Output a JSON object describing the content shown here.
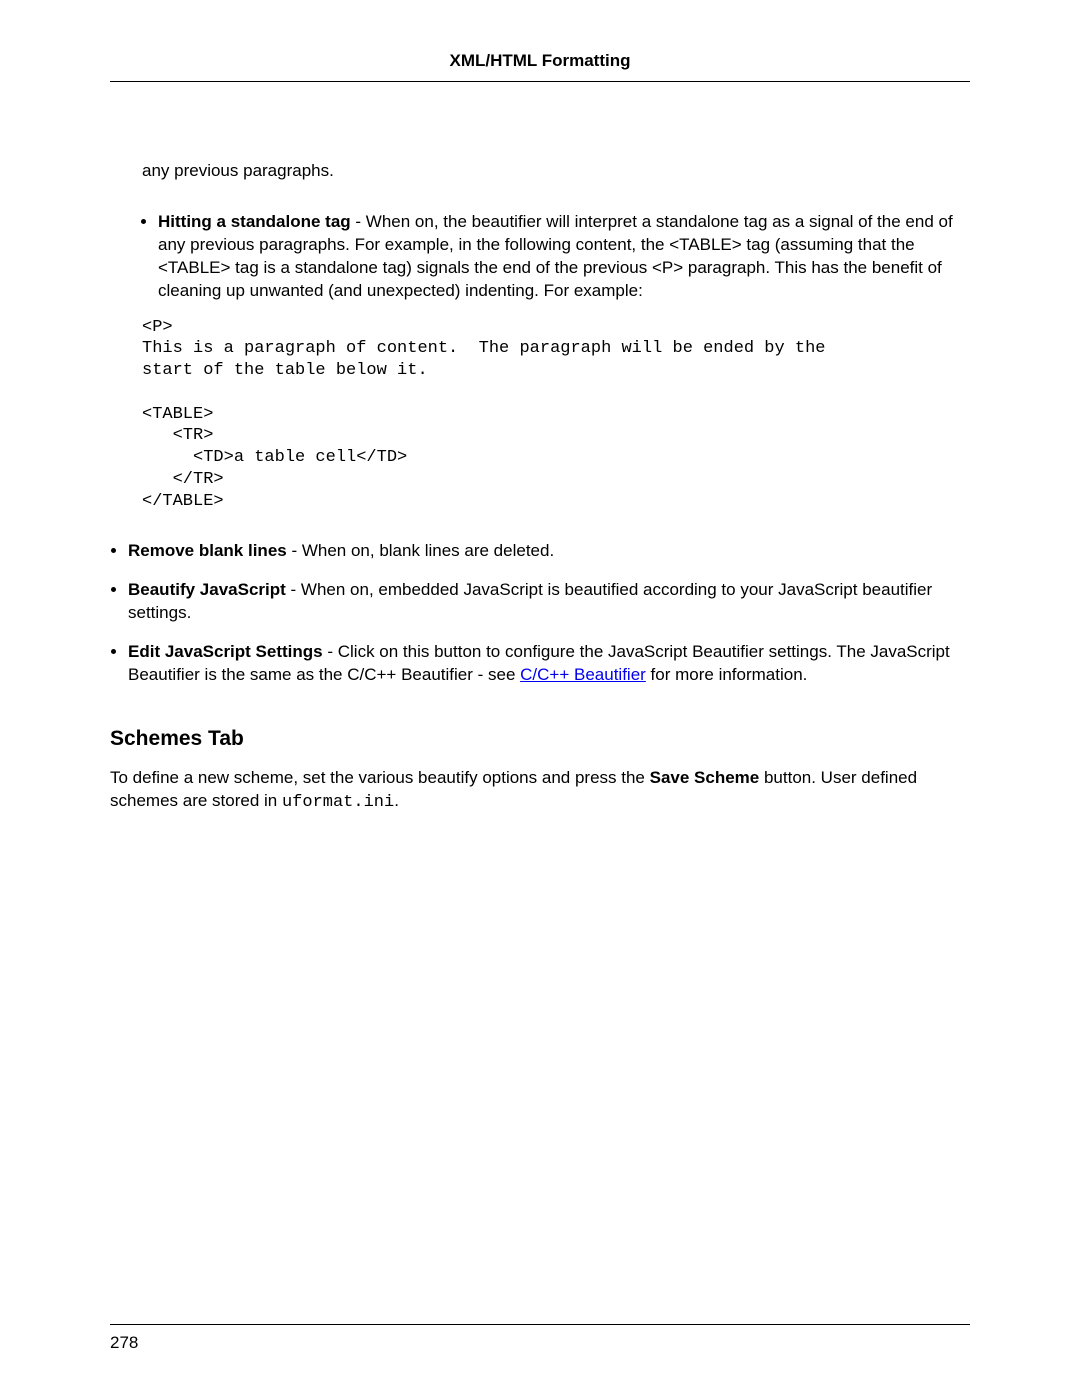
{
  "header": {
    "title": "XML/HTML Formatting"
  },
  "continuation": "any previous paragraphs.",
  "nested_bullet": {
    "label": "Hitting a standalone tag",
    "text": " - When on, the beautifier will interpret a standalone tag as a signal of the end of any previous paragraphs. For example, in the following content, the <TABLE> tag (assuming that the <TABLE> tag is a standalone tag) signals the end of the previous <P> paragraph. This has the benefit of cleaning up unwanted (and unexpected) indenting. For example:"
  },
  "code": "<P>\nThis is a paragraph of content.  The paragraph will be ended by the\nstart of the table below it.\n\n<TABLE>\n   <TR>\n     <TD>a table cell</TD>\n   </TR>\n</TABLE>",
  "bullets": [
    {
      "label": "Remove blank lines",
      "text": " - When on, blank lines are deleted."
    },
    {
      "label": "Beautify JavaScript",
      "text": " - When on, embedded JavaScript is beautified according to your JavaScript beautifier settings."
    },
    {
      "label": "Edit JavaScript Settings",
      "text_before_link": " - Click on this button to configure the JavaScript Beautifier settings. The JavaScript Beautifier is the same as the C/C++ Beautifier - see ",
      "link_text": "C/C++ Beautifier",
      "text_after_link": " for more information."
    }
  ],
  "section": {
    "heading": "Schemes Tab",
    "para_before_bold": "To define a new scheme, set the various beautify options and press the ",
    "bold": "Save Scheme",
    "para_after_bold": " button. User defined schemes are stored in ",
    "mono": "uformat.ini",
    "para_end": "."
  },
  "footer": {
    "page_number": "278"
  }
}
